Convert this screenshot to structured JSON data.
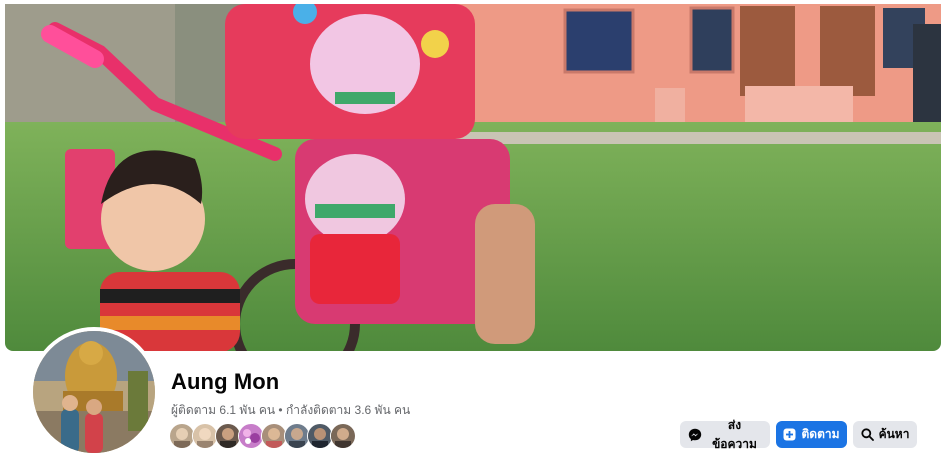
{
  "profile": {
    "name": "Aung Mon",
    "stats": "ผู้ติดตาม 6.1 พัน คน • กำลังติดตาม 3.6 พัน คน"
  },
  "friends": {
    "count_shown": 8,
    "colors": [
      "#b9a58c",
      "#d8c2a8",
      "#6b5a4e",
      "#c77dc9",
      "#a88f7a",
      "#6e7c8c",
      "#4f5a66",
      "#7a6858"
    ]
  },
  "actions": {
    "message_label": "ส่งข้อความ",
    "follow_label": "ติดตาม",
    "search_label": "ค้นหา"
  },
  "icons": {
    "message": "messenger-icon",
    "follow": "follow-plus-icon",
    "search": "search-icon"
  },
  "colors": {
    "primary_blue": "#1b74e4",
    "button_gray": "#e4e6eb",
    "text_dark": "#050505",
    "text_secondary": "#65676b"
  }
}
